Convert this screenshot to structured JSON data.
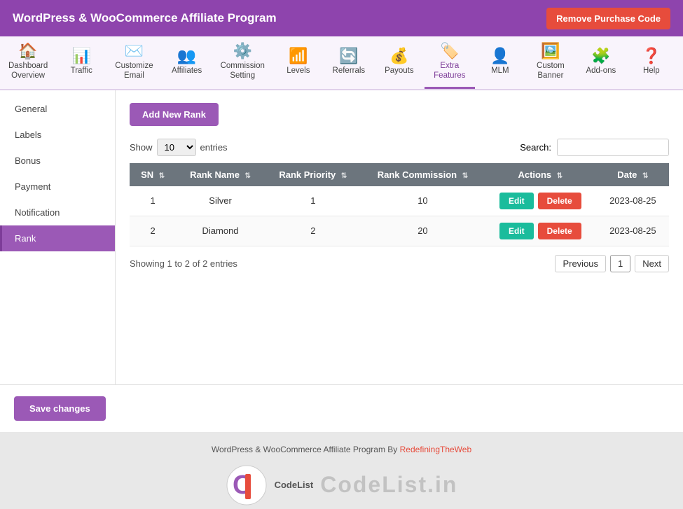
{
  "header": {
    "title": "WordPress & WooCommerce Affiliate Program",
    "remove_btn_label": "Remove Purchase Code"
  },
  "nav": {
    "items": [
      {
        "id": "dashboard-overview",
        "icon": "🏠",
        "label": "Dashboard\nOverview",
        "active": false
      },
      {
        "id": "traffic",
        "icon": "📊",
        "label": "Traffic",
        "active": false
      },
      {
        "id": "customize-email",
        "icon": "✉️",
        "label": "Customize\nEmail",
        "active": false
      },
      {
        "id": "affiliates",
        "icon": "👥",
        "label": "Affiliates",
        "active": false
      },
      {
        "id": "commission-setting",
        "icon": "⚙️",
        "label": "Commission\nSetting",
        "active": false
      },
      {
        "id": "levels",
        "icon": "📶",
        "label": "Levels",
        "active": false
      },
      {
        "id": "referrals",
        "icon": "🔄",
        "label": "Referrals",
        "active": false
      },
      {
        "id": "payouts",
        "icon": "💰",
        "label": "Payouts",
        "active": false
      },
      {
        "id": "extra-features",
        "icon": "🏷️",
        "label": "Extra\nFeatures",
        "active": true
      },
      {
        "id": "mlm",
        "icon": "👤",
        "label": "MLM",
        "active": false
      },
      {
        "id": "custom-banner",
        "icon": "🖼️",
        "label": "Custom\nBanner",
        "active": false
      },
      {
        "id": "add-ons",
        "icon": "🧩",
        "label": "Add-ons",
        "active": false
      },
      {
        "id": "help",
        "icon": "❓",
        "label": "Help",
        "active": false
      }
    ]
  },
  "sidebar": {
    "items": [
      {
        "id": "general",
        "label": "General",
        "active": false
      },
      {
        "id": "labels",
        "label": "Labels",
        "active": false
      },
      {
        "id": "bonus",
        "label": "Bonus",
        "active": false
      },
      {
        "id": "payment",
        "label": "Payment",
        "active": false
      },
      {
        "id": "notification",
        "label": "Notification",
        "active": false
      },
      {
        "id": "rank",
        "label": "Rank",
        "active": true
      }
    ]
  },
  "content": {
    "add_new_rank_label": "Add New Rank",
    "show_label": "Show",
    "entries_label": "entries",
    "search_label": "Search:",
    "search_placeholder": "",
    "show_value": "10",
    "table": {
      "columns": [
        "SN",
        "Rank Name",
        "Rank Priority",
        "Rank Commission",
        "Actions",
        "Date"
      ],
      "rows": [
        {
          "sn": "1",
          "rank_name": "Silver",
          "rank_priority": "1",
          "rank_commission": "10",
          "date": "2023-08-25"
        },
        {
          "sn": "2",
          "rank_name": "Diamond",
          "rank_priority": "2",
          "rank_commission": "20",
          "date": "2023-08-25"
        }
      ]
    },
    "edit_label": "Edit",
    "delete_label": "Delete",
    "pagination": {
      "showing_text": "Showing 1 to 2 of 2 entries",
      "previous_label": "Previous",
      "current_page": "1",
      "next_label": "Next"
    }
  },
  "save_changes_label": "Save changes",
  "footer": {
    "text": "WordPress & WooCommerce Affiliate Program By ",
    "link_text": "RedefiningTheWeb",
    "brand": "CodeList.in"
  },
  "colors": {
    "primary": "#9b59b6",
    "header_bg": "#8e44ad",
    "danger": "#e74c3c",
    "teal": "#1abc9c"
  }
}
